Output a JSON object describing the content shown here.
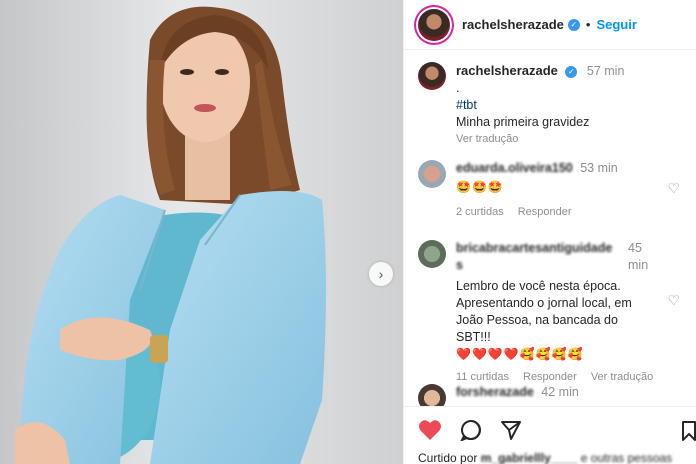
{
  "header": {
    "username": "rachelsherazade",
    "follow_label": "Seguir",
    "separator": "•"
  },
  "caption": {
    "username": "rachelsherazade",
    "time": "57 min",
    "dot": ".",
    "hashtag": "#tbt",
    "text": "Minha primeira gravidez",
    "translate": "Ver tradução"
  },
  "comments": [
    {
      "username": "eduarda.oliveira150",
      "time": "53 min",
      "text": "🤩🤩🤩",
      "likes": "2 curtidas",
      "reply": "Responder",
      "translate": ""
    },
    {
      "username": "bricabracartesantiguidades",
      "time": "45 min",
      "text": "Lembro de você nesta época. Apresentando o jornal local, em João Pessoa, na bancada do SBT!!!",
      "emojis": "❤️❤️❤️❤️🥰🥰🥰🥰",
      "likes": "11 curtidas",
      "reply": "Responder",
      "translate": "Ver tradução"
    },
    {
      "username": "forsherazade",
      "time": "42 min",
      "text": "",
      "likes": "",
      "reply": "",
      "translate": ""
    }
  ],
  "actions": {
    "liked_prefix": "Curtido por",
    "liked_user": "m_gabriellly____",
    "liked_suffix": "e outras pessoas"
  },
  "colors": {
    "accent": "#0095f6",
    "like_red": "#ed4956",
    "jacket": "#9ccfe8"
  }
}
